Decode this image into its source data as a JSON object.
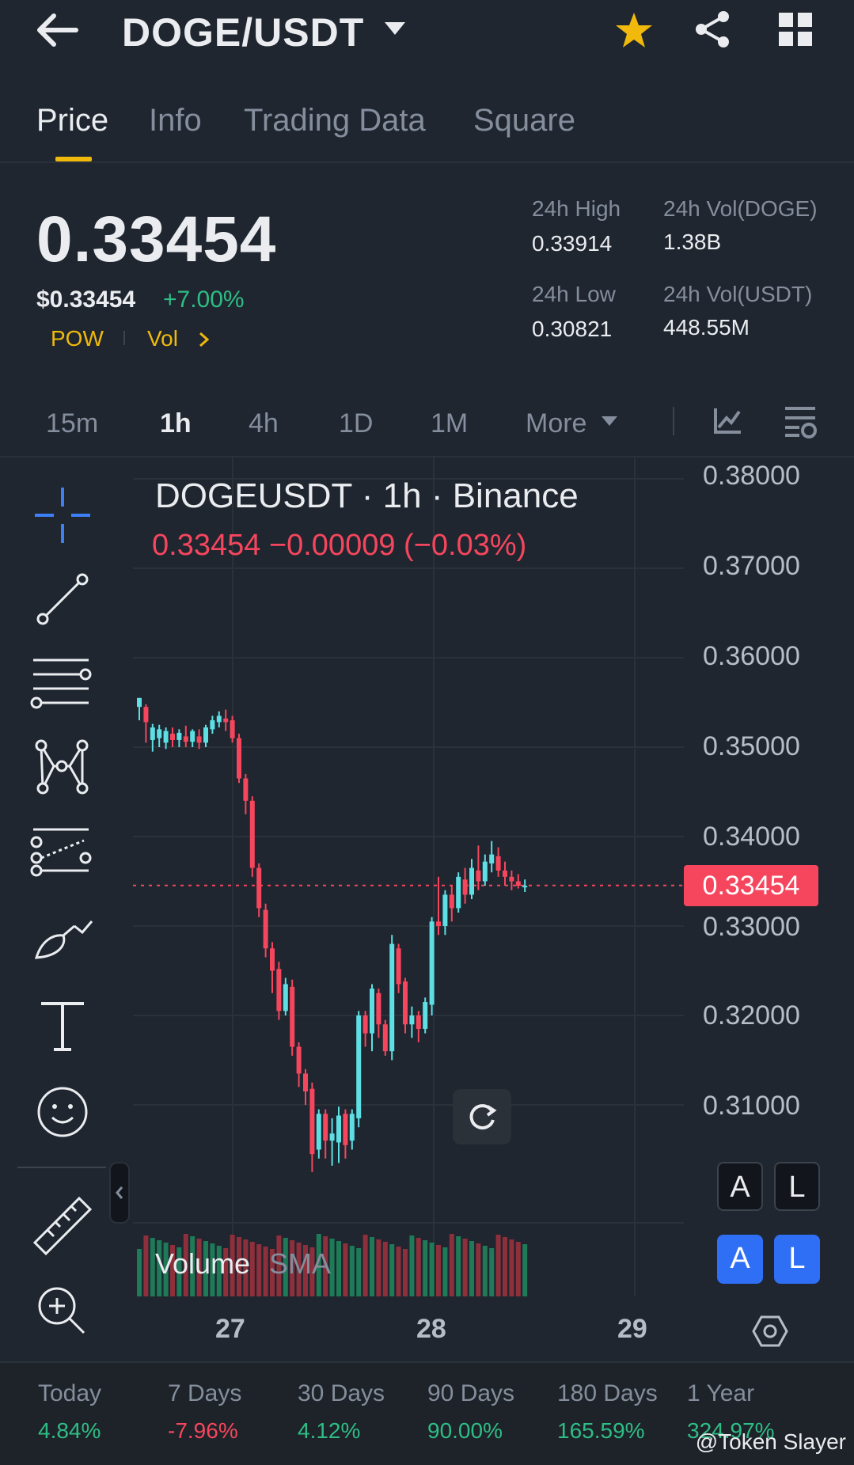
{
  "header": {
    "title": "DOGE/USDT",
    "icons": {
      "back": "back-arrow-icon",
      "dropdown": "caret-down-icon",
      "favorite": "star-icon",
      "share": "share-icon",
      "grid": "grid-icon"
    },
    "favorite_color": "#f0b90b"
  },
  "tabs": [
    {
      "label": "Price",
      "active": true
    },
    {
      "label": "Info",
      "active": false
    },
    {
      "label": "Trading Data",
      "active": false
    },
    {
      "label": "Square",
      "active": false
    }
  ],
  "ticker": {
    "last_price": "0.33454",
    "usd_price": "$0.33454",
    "change_pct": "+7.00%",
    "tags": [
      "POW",
      "Vol"
    ],
    "stats": {
      "high_label": "24h High",
      "high_value": "0.33914",
      "low_label": "24h Low",
      "low_value": "0.30821",
      "vol_base_label": "24h Vol(DOGE)",
      "vol_base_value": "1.38B",
      "vol_quote_label": "24h Vol(USDT)",
      "vol_quote_value": "448.55M"
    }
  },
  "intervals": {
    "items": [
      {
        "label": "15m",
        "active": false
      },
      {
        "label": "1h",
        "active": true
      },
      {
        "label": "4h",
        "active": false
      },
      {
        "label": "1D",
        "active": false
      },
      {
        "label": "1M",
        "active": false
      }
    ],
    "more_label": "More"
  },
  "chart": {
    "legend_title": "DOGEUSDT · 1h · Binance",
    "legend_ohlc": "0.33454  −0.00009 (−0.03%)",
    "price_labels": [
      "0.38000",
      "0.37000",
      "0.36000",
      "0.35000",
      "0.34000",
      "0.33000",
      "0.32000",
      "0.31000"
    ],
    "last_price_tag": "0.33454",
    "date_labels": [
      "27",
      "28",
      "29"
    ],
    "volume_label": "Volume",
    "volume_sma_label": "SMA",
    "auto_label": "A",
    "log_label": "L",
    "up_color": "#2ebd85",
    "down_color": "#f6465d",
    "candle_up_color": "#5ddfe3",
    "tools": [
      "crosshair-icon",
      "trend-line-icon",
      "fib-retracement-icon",
      "pattern-icon",
      "parallel-channel-icon",
      "brush-icon",
      "text-icon",
      "emoji-icon",
      "ruler-icon",
      "zoom-in-icon"
    ]
  },
  "chart_data": {
    "type": "candlestick",
    "ylim": [
      0.305,
      0.385
    ],
    "ticks_y": [
      0.38,
      0.37,
      0.36,
      0.35,
      0.34,
      0.33,
      0.32,
      0.31
    ],
    "x_ticks": [
      "27",
      "28",
      "29"
    ],
    "last_price": 0.33454,
    "candles": [
      [
        0.3545,
        0.3555,
        0.353,
        0.3555
      ],
      [
        0.3545,
        0.3528,
        0.3505,
        0.3548
      ],
      [
        0.3508,
        0.3522,
        0.3495,
        0.3526
      ],
      [
        0.351,
        0.352,
        0.35,
        0.3525
      ],
      [
        0.3505,
        0.3518,
        0.3498,
        0.3522
      ],
      [
        0.3515,
        0.3508,
        0.35,
        0.3522
      ],
      [
        0.3508,
        0.3516,
        0.35,
        0.352
      ],
      [
        0.3512,
        0.3506,
        0.35,
        0.3524
      ],
      [
        0.3506,
        0.3518,
        0.35,
        0.352
      ],
      [
        0.3512,
        0.3505,
        0.3498,
        0.352
      ],
      [
        0.3505,
        0.3522,
        0.35,
        0.3525
      ],
      [
        0.352,
        0.353,
        0.3515,
        0.3535
      ],
      [
        0.3528,
        0.3535,
        0.3522,
        0.354
      ],
      [
        0.3532,
        0.3528,
        0.3518,
        0.3542
      ],
      [
        0.353,
        0.351,
        0.3505,
        0.3535
      ],
      [
        0.351,
        0.3465,
        0.346,
        0.3515
      ],
      [
        0.3465,
        0.344,
        0.3425,
        0.347
      ],
      [
        0.344,
        0.3365,
        0.3355,
        0.3445
      ],
      [
        0.3365,
        0.332,
        0.331,
        0.337
      ],
      [
        0.3318,
        0.3275,
        0.3265,
        0.3325
      ],
      [
        0.3275,
        0.325,
        0.3225,
        0.3282
      ],
      [
        0.3252,
        0.3205,
        0.3195,
        0.326
      ],
      [
        0.3205,
        0.3235,
        0.32,
        0.3242
      ],
      [
        0.3232,
        0.3165,
        0.3155,
        0.324
      ],
      [
        0.3165,
        0.3135,
        0.312,
        0.317
      ],
      [
        0.3135,
        0.3115,
        0.31,
        0.314
      ],
      [
        0.3118,
        0.3045,
        0.3025,
        0.3125
      ],
      [
        0.305,
        0.309,
        0.304,
        0.3095
      ],
      [
        0.309,
        0.306,
        0.304,
        0.3095
      ],
      [
        0.306,
        0.3068,
        0.3032,
        0.3085
      ],
      [
        0.3058,
        0.3088,
        0.3035,
        0.3098
      ],
      [
        0.309,
        0.3055,
        0.304,
        0.3095
      ],
      [
        0.306,
        0.309,
        0.305,
        0.3095
      ],
      [
        0.3085,
        0.32,
        0.3075,
        0.3205
      ],
      [
        0.32,
        0.318,
        0.3165,
        0.3205
      ],
      [
        0.318,
        0.323,
        0.316,
        0.3235
      ],
      [
        0.3225,
        0.319,
        0.3175,
        0.323
      ],
      [
        0.319,
        0.316,
        0.3155,
        0.3195
      ],
      [
        0.316,
        0.328,
        0.315,
        0.329
      ],
      [
        0.3275,
        0.3235,
        0.3225,
        0.328
      ],
      [
        0.3238,
        0.319,
        0.318,
        0.3242
      ],
      [
        0.319,
        0.32,
        0.3175,
        0.321
      ],
      [
        0.32,
        0.3185,
        0.317,
        0.3205
      ],
      [
        0.3185,
        0.3215,
        0.318,
        0.322
      ],
      [
        0.3212,
        0.3305,
        0.32,
        0.331
      ],
      [
        0.3305,
        0.33,
        0.329,
        0.3355
      ],
      [
        0.33,
        0.3335,
        0.329,
        0.334
      ],
      [
        0.3335,
        0.332,
        0.3305,
        0.3345
      ],
      [
        0.332,
        0.3355,
        0.3315,
        0.336
      ],
      [
        0.3352,
        0.3335,
        0.3325,
        0.3365
      ],
      [
        0.3335,
        0.3365,
        0.333,
        0.3375
      ],
      [
        0.3362,
        0.335,
        0.334,
        0.339
      ],
      [
        0.335,
        0.3372,
        0.3345,
        0.338
      ],
      [
        0.337,
        0.338,
        0.336,
        0.3395
      ],
      [
        0.3378,
        0.3362,
        0.3355,
        0.3388
      ],
      [
        0.3362,
        0.3355,
        0.3345,
        0.3372
      ],
      [
        0.3355,
        0.335,
        0.334,
        0.3362
      ],
      [
        0.335,
        0.3345,
        0.3342,
        0.3358
      ],
      [
        0.3345,
        0.3345,
        0.3338,
        0.3352
      ]
    ]
  },
  "performance": [
    {
      "label": "Today",
      "value": "4.84%",
      "dir": "up"
    },
    {
      "label": "7 Days",
      "value": "-7.96%",
      "dir": "down"
    },
    {
      "label": "30 Days",
      "value": "4.12%",
      "dir": "up"
    },
    {
      "label": "90 Days",
      "value": "90.00%",
      "dir": "up"
    },
    {
      "label": "180 Days",
      "value": "165.59%",
      "dir": "up"
    },
    {
      "label": "1 Year",
      "value": "324.97%",
      "dir": "up"
    }
  ],
  "watermark": "@Token Slayer"
}
